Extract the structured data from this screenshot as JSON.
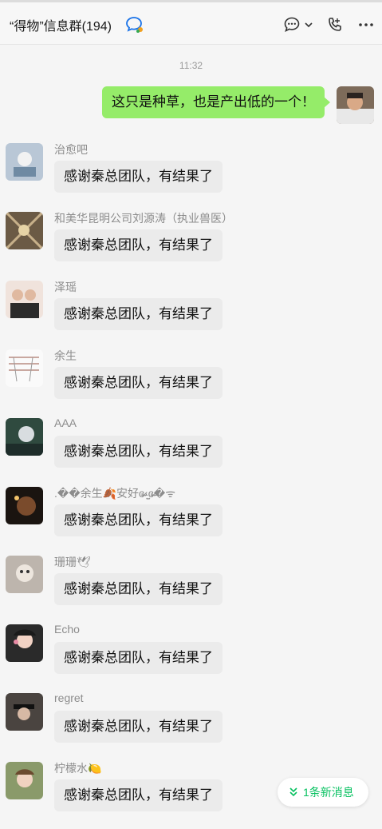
{
  "header": {
    "title": "“得物”信息群(194)",
    "icons": [
      "group-chat-icon",
      "chat-bubble-icon",
      "chevron-down-icon",
      "phone-icon",
      "more-icon"
    ]
  },
  "chat": {
    "timestamp": "11:32",
    "my_message": "这只是种草，也是产出低的一个！",
    "messages": [
      {
        "sender": "治愈吧",
        "text": "感谢秦总团队，有结果了"
      },
      {
        "sender": "和美华昆明公司刘源涛（执业兽医）",
        "text": "感谢秦总团队，有结果了"
      },
      {
        "sender": "泽瑶",
        "text": "感谢秦总团队，有结果了"
      },
      {
        "sender": "余生",
        "text": "感谢秦总团队，有结果了"
      },
      {
        "sender": "AAA",
        "text": "感谢秦总团队，有结果了"
      },
      {
        "sender": ".��余生🍂安好ɞ̴̶̷·̫̮ɞ̴̶̷�ᯤ",
        "text": "感谢秦总团队，有结果了"
      },
      {
        "sender": "珊珊🕊",
        "text": "感谢秦总团队，有结果了"
      },
      {
        "sender": "Echo",
        "text": "感谢秦总团队，有结果了"
      },
      {
        "sender": "regret",
        "text": "感谢秦总团队，有结果了"
      },
      {
        "sender": "柠檬水🍋",
        "text": "感谢秦总团队，有结果了"
      }
    ]
  },
  "new_message_button": {
    "label": "1条新消息"
  },
  "colors": {
    "my_bubble": "#95ec69",
    "other_bubble": "#ebebeb",
    "accent": "#07c160"
  }
}
